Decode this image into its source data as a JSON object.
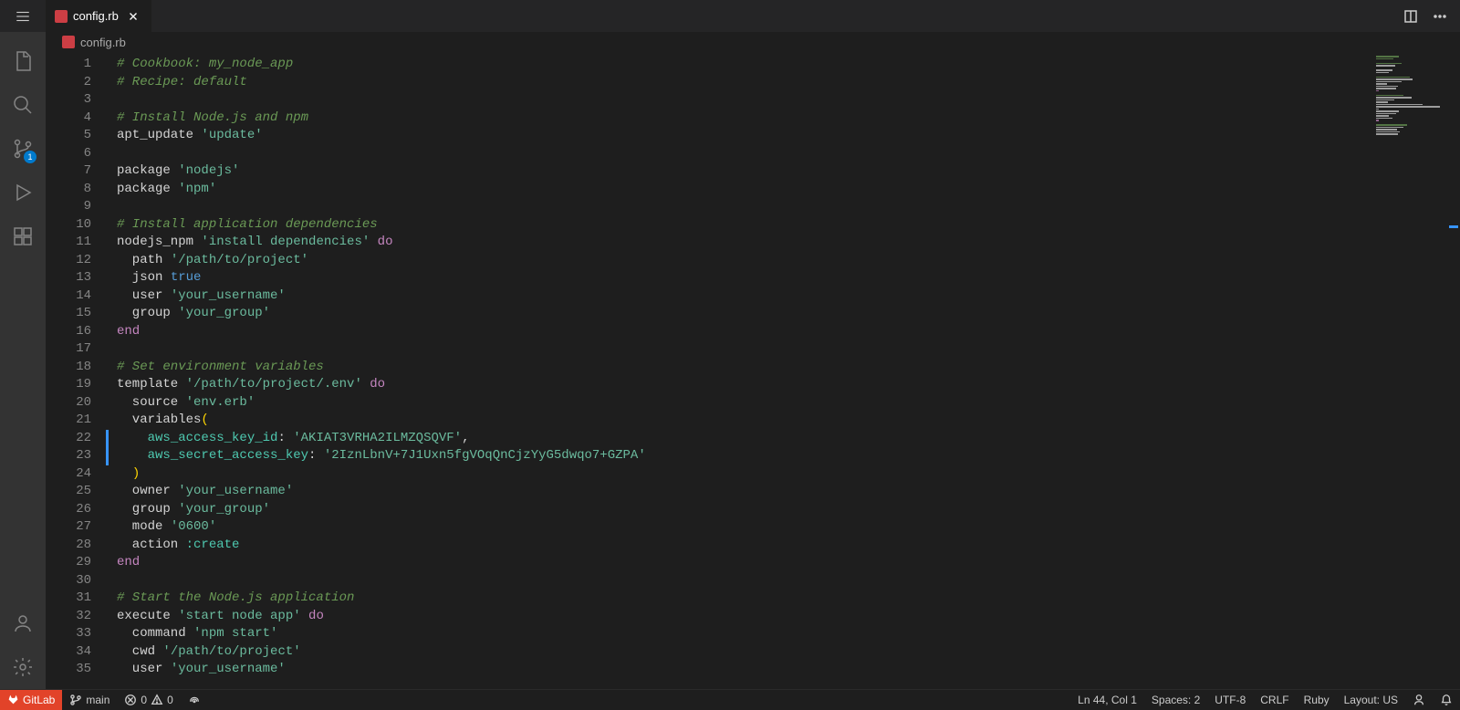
{
  "tab": {
    "filename": "config.rb"
  },
  "breadcrumb": {
    "filename": "config.rb"
  },
  "scm_badge": "1",
  "status": {
    "gitlab": "GitLab",
    "branch": "main",
    "errors": "0",
    "warnings": "0",
    "position": "Ln 44, Col 1",
    "spaces": "Spaces: 2",
    "encoding": "UTF-8",
    "eol": "CRLF",
    "lang": "Ruby",
    "layout": "Layout: US"
  },
  "code_lines": [
    [
      {
        "c": "c-comment",
        "t": "# Cookbook: my_node_app"
      }
    ],
    [
      {
        "c": "c-comment",
        "t": "# Recipe: default"
      }
    ],
    [],
    [
      {
        "c": "c-comment",
        "t": "# Install Node.js and npm"
      }
    ],
    [
      {
        "c": "c-ident",
        "t": "apt_update "
      },
      {
        "c": "c-string2",
        "t": "'update'"
      }
    ],
    [],
    [
      {
        "c": "c-ident",
        "t": "package "
      },
      {
        "c": "c-string2",
        "t": "'nodejs'"
      }
    ],
    [
      {
        "c": "c-ident",
        "t": "package "
      },
      {
        "c": "c-string2",
        "t": "'npm'"
      }
    ],
    [],
    [
      {
        "c": "c-comment",
        "t": "# Install application dependencies"
      }
    ],
    [
      {
        "c": "c-ident",
        "t": "nodejs_npm "
      },
      {
        "c": "c-string2",
        "t": "'install dependencies'"
      },
      {
        "c": "c-ident",
        "t": " "
      },
      {
        "c": "c-keyword",
        "t": "do"
      }
    ],
    [
      {
        "c": "c-ident",
        "t": "  path "
      },
      {
        "c": "c-string2",
        "t": "'/path/to/project'"
      }
    ],
    [
      {
        "c": "c-ident",
        "t": "  json "
      },
      {
        "c": "c-true",
        "t": "true"
      }
    ],
    [
      {
        "c": "c-ident",
        "t": "  user "
      },
      {
        "c": "c-string2",
        "t": "'your_username'"
      }
    ],
    [
      {
        "c": "c-ident",
        "t": "  group "
      },
      {
        "c": "c-string2",
        "t": "'your_group'"
      }
    ],
    [
      {
        "c": "c-keyword",
        "t": "end"
      }
    ],
    [],
    [
      {
        "c": "c-comment",
        "t": "# Set environment variables"
      }
    ],
    [
      {
        "c": "c-ident",
        "t": "template "
      },
      {
        "c": "c-string2",
        "t": "'/path/to/project/.env'"
      },
      {
        "c": "c-ident",
        "t": " "
      },
      {
        "c": "c-keyword",
        "t": "do"
      }
    ],
    [
      {
        "c": "c-ident",
        "t": "  source "
      },
      {
        "c": "c-string2",
        "t": "'env.erb'"
      }
    ],
    [
      {
        "c": "c-ident",
        "t": "  variables"
      },
      {
        "c": "c-punct",
        "t": "("
      }
    ],
    [
      {
        "c": "c-ident",
        "t": "    "
      },
      {
        "c": "c-symbol",
        "t": "aws_access_key_id"
      },
      {
        "c": "c-ident",
        "t": ": "
      },
      {
        "c": "c-string2",
        "t": "'AKIAT3VRHA2ILMZQSQVF'"
      },
      {
        "c": "c-ident",
        "t": ","
      }
    ],
    [
      {
        "c": "c-ident",
        "t": "    "
      },
      {
        "c": "c-symbol",
        "t": "aws_secret_access_key"
      },
      {
        "c": "c-ident",
        "t": ": "
      },
      {
        "c": "c-string2",
        "t": "'2IznLbnV+7J1Uxn5fgVOqQnCjzYyG5dwqo7+GZPA'"
      }
    ],
    [
      {
        "c": "c-ident",
        "t": "  "
      },
      {
        "c": "c-punct",
        "t": ")"
      }
    ],
    [
      {
        "c": "c-ident",
        "t": "  owner "
      },
      {
        "c": "c-string2",
        "t": "'your_username'"
      }
    ],
    [
      {
        "c": "c-ident",
        "t": "  group "
      },
      {
        "c": "c-string2",
        "t": "'your_group'"
      }
    ],
    [
      {
        "c": "c-ident",
        "t": "  mode "
      },
      {
        "c": "c-string2",
        "t": "'0600'"
      }
    ],
    [
      {
        "c": "c-ident",
        "t": "  action "
      },
      {
        "c": "c-symbol",
        "t": ":create"
      }
    ],
    [
      {
        "c": "c-keyword",
        "t": "end"
      }
    ],
    [],
    [
      {
        "c": "c-comment",
        "t": "# Start the Node.js application"
      }
    ],
    [
      {
        "c": "c-ident",
        "t": "execute "
      },
      {
        "c": "c-string2",
        "t": "'start node app'"
      },
      {
        "c": "c-ident",
        "t": " "
      },
      {
        "c": "c-keyword",
        "t": "do"
      }
    ],
    [
      {
        "c": "c-ident",
        "t": "  command "
      },
      {
        "c": "c-string2",
        "t": "'npm start'"
      }
    ],
    [
      {
        "c": "c-ident",
        "t": "  cwd "
      },
      {
        "c": "c-string2",
        "t": "'/path/to/project'"
      }
    ],
    [
      {
        "c": "c-ident",
        "t": "  user "
      },
      {
        "c": "c-string2",
        "t": "'your_username'"
      }
    ]
  ]
}
